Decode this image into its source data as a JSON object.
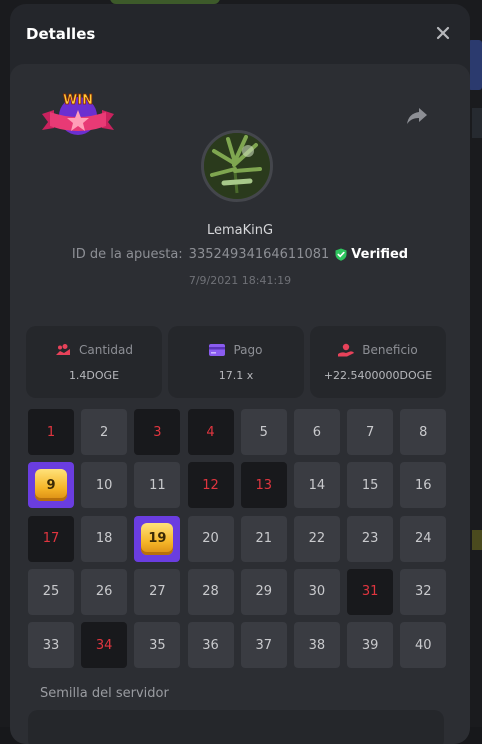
{
  "modal": {
    "title": "Detalles"
  },
  "bet": {
    "username": "LemaKinG",
    "id_label": "ID de la apuesta:",
    "id_value": "33524934164611081",
    "verified_label": "Verified",
    "timestamp": "7/9/2021 18:41:19",
    "badge_text": "WIN"
  },
  "stats": [
    {
      "label": "Cantidad",
      "value": "1.4DOGE",
      "icon": "coins-hand-icon"
    },
    {
      "label": "Pago",
      "value": "17.1 x",
      "icon": "card-icon"
    },
    {
      "label": "Beneficio",
      "value": "+22.5400000DOGE",
      "icon": "profit-hand-icon"
    }
  ],
  "board": {
    "numbers": [
      1,
      2,
      3,
      4,
      5,
      6,
      7,
      8,
      9,
      10,
      11,
      12,
      13,
      14,
      15,
      16,
      17,
      18,
      19,
      20,
      21,
      22,
      23,
      24,
      25,
      26,
      27,
      28,
      29,
      30,
      31,
      32,
      33,
      34,
      35,
      36,
      37,
      38,
      39,
      40
    ],
    "picked_hits": [
      1,
      3,
      4,
      12,
      13,
      17,
      31,
      34
    ],
    "winning_picks": [
      9,
      19
    ]
  },
  "seed": {
    "label": "Semilla del servidor"
  },
  "colors": {
    "hit": "#e0353f",
    "win": "#6a3de0",
    "accent": "#ffffff"
  }
}
